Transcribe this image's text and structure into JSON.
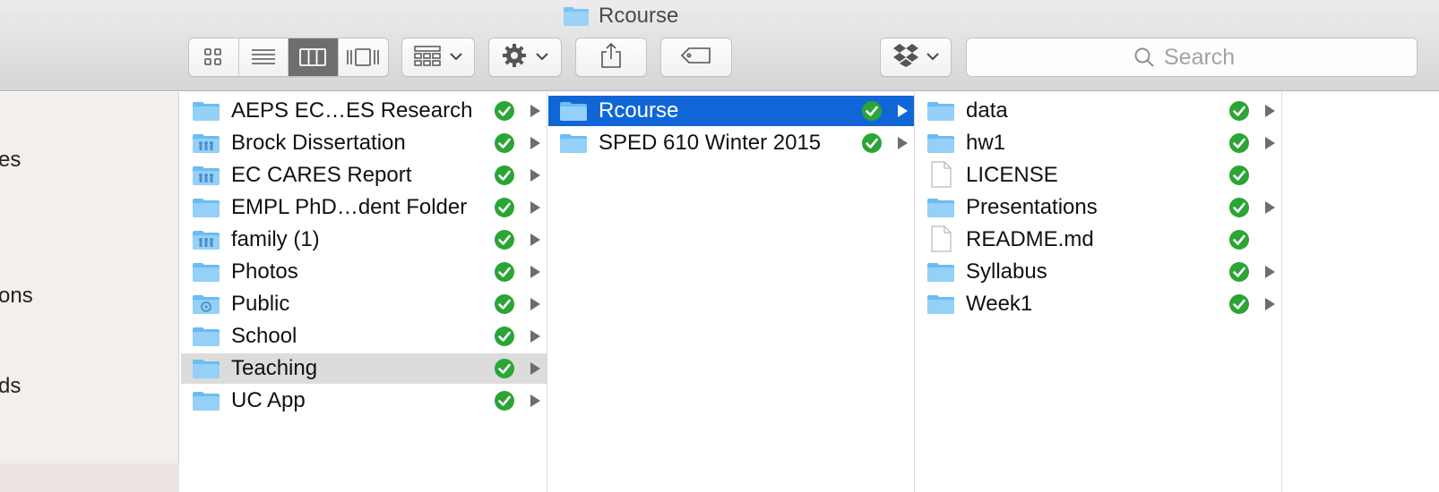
{
  "window": {
    "title": "Rcourse"
  },
  "toolbar": {
    "view_buttons": [
      {
        "name": "icon-view",
        "icon": "icon-grid-icon",
        "active": false
      },
      {
        "name": "list-view",
        "icon": "list-icon",
        "active": false
      },
      {
        "name": "column-view",
        "icon": "columns-icon",
        "active": true
      },
      {
        "name": "cover-flow-view",
        "icon": "cover-flow-icon",
        "active": false
      }
    ],
    "arrange_icon": "arrange-grid-icon",
    "action_icon": "gear-icon",
    "share_icon": "share-icon",
    "tag_icon": "tag-icon",
    "dropbox_icon": "dropbox-icon",
    "search": {
      "placeholder": "Search"
    }
  },
  "sidebar": {
    "items": [
      {
        "label": "es"
      },
      {
        "label": "ons"
      },
      {
        "label": "ds"
      }
    ]
  },
  "colors": {
    "selection": "#1066d6",
    "highlight": "#dcdcdc",
    "sync_green": "#2aa536",
    "folder_blue": "#7cc4f3"
  },
  "columns": [
    {
      "items": [
        {
          "label": "AEPS EC…ES Research",
          "icon": "folder",
          "synced": true,
          "expandable": true,
          "state": ""
        },
        {
          "label": "Brock Dissertation",
          "icon": "shared-folder",
          "synced": true,
          "expandable": true,
          "state": ""
        },
        {
          "label": "EC CARES Report",
          "icon": "shared-folder",
          "synced": true,
          "expandable": true,
          "state": ""
        },
        {
          "label": "EMPL PhD…dent Folder",
          "icon": "folder",
          "synced": true,
          "expandable": true,
          "state": ""
        },
        {
          "label": "family (1)",
          "icon": "shared-folder",
          "synced": true,
          "expandable": true,
          "state": ""
        },
        {
          "label": "Photos",
          "icon": "folder",
          "synced": true,
          "expandable": true,
          "state": ""
        },
        {
          "label": "Public",
          "icon": "public-folder",
          "synced": true,
          "expandable": true,
          "state": ""
        },
        {
          "label": "School",
          "icon": "folder",
          "synced": true,
          "expandable": true,
          "state": ""
        },
        {
          "label": "Teaching",
          "icon": "folder",
          "synced": true,
          "expandable": true,
          "state": "highlight"
        },
        {
          "label": "UC App",
          "icon": "folder",
          "synced": true,
          "expandable": true,
          "state": ""
        }
      ]
    },
    {
      "items": [
        {
          "label": "Rcourse",
          "icon": "folder",
          "synced": true,
          "expandable": true,
          "state": "selected"
        },
        {
          "label": "SPED 610 Winter 2015",
          "icon": "folder",
          "synced": true,
          "expandable": true,
          "state": ""
        }
      ]
    },
    {
      "items": [
        {
          "label": "data",
          "icon": "folder",
          "synced": true,
          "expandable": true,
          "state": ""
        },
        {
          "label": "hw1",
          "icon": "folder",
          "synced": true,
          "expandable": true,
          "state": ""
        },
        {
          "label": "LICENSE",
          "icon": "document",
          "synced": true,
          "expandable": false,
          "state": ""
        },
        {
          "label": "Presentations",
          "icon": "folder",
          "synced": true,
          "expandable": true,
          "state": ""
        },
        {
          "label": "README.md",
          "icon": "document",
          "synced": true,
          "expandable": false,
          "state": ""
        },
        {
          "label": "Syllabus",
          "icon": "folder",
          "synced": true,
          "expandable": true,
          "state": ""
        },
        {
          "label": "Week1",
          "icon": "folder",
          "synced": true,
          "expandable": true,
          "state": ""
        }
      ]
    },
    {
      "items": []
    }
  ]
}
